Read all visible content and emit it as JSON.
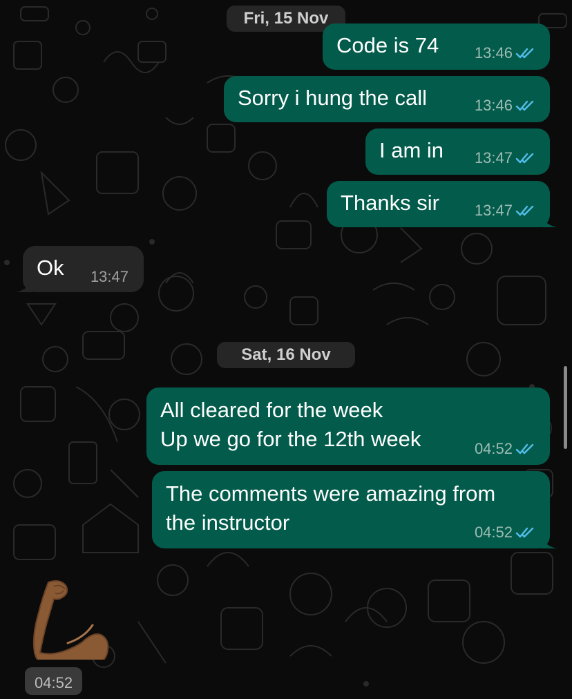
{
  "chat": {
    "dates": [
      "Fri, 15 Nov",
      "Sat, 16 Nov"
    ],
    "messages": [
      {
        "text": "Code is 74",
        "time": "13:46",
        "direction": "outgoing",
        "status": "read"
      },
      {
        "text": "Sorry i hung the call",
        "time": "13:46",
        "direction": "outgoing",
        "status": "read"
      },
      {
        "text": "I am in",
        "time": "13:47",
        "direction": "outgoing",
        "status": "read"
      },
      {
        "text": "Thanks sir",
        "time": "13:47",
        "direction": "outgoing",
        "status": "read"
      },
      {
        "text": "Ok",
        "time": "13:47",
        "direction": "incoming"
      },
      {
        "lines": [
          "All cleared for the week",
          "Up we go for the 12th week"
        ],
        "time": "04:52",
        "direction": "outgoing",
        "status": "read"
      },
      {
        "lines": [
          "The comments were amazing from",
          "the instructor"
        ],
        "time": "04:52",
        "direction": "outgoing",
        "status": "read"
      },
      {
        "sticker": "flexed-biceps-medium-dark-skin-sticker",
        "time": "04:52",
        "direction": "incoming"
      }
    ]
  },
  "colors": {
    "outgoing_bubble": "#035c4b",
    "incoming_bubble": "#262626",
    "read_ticks": "#53bdeb",
    "background": "#0b0b0b"
  },
  "icons": [
    "double-check-read-icon",
    "flexed-biceps-sticker"
  ]
}
